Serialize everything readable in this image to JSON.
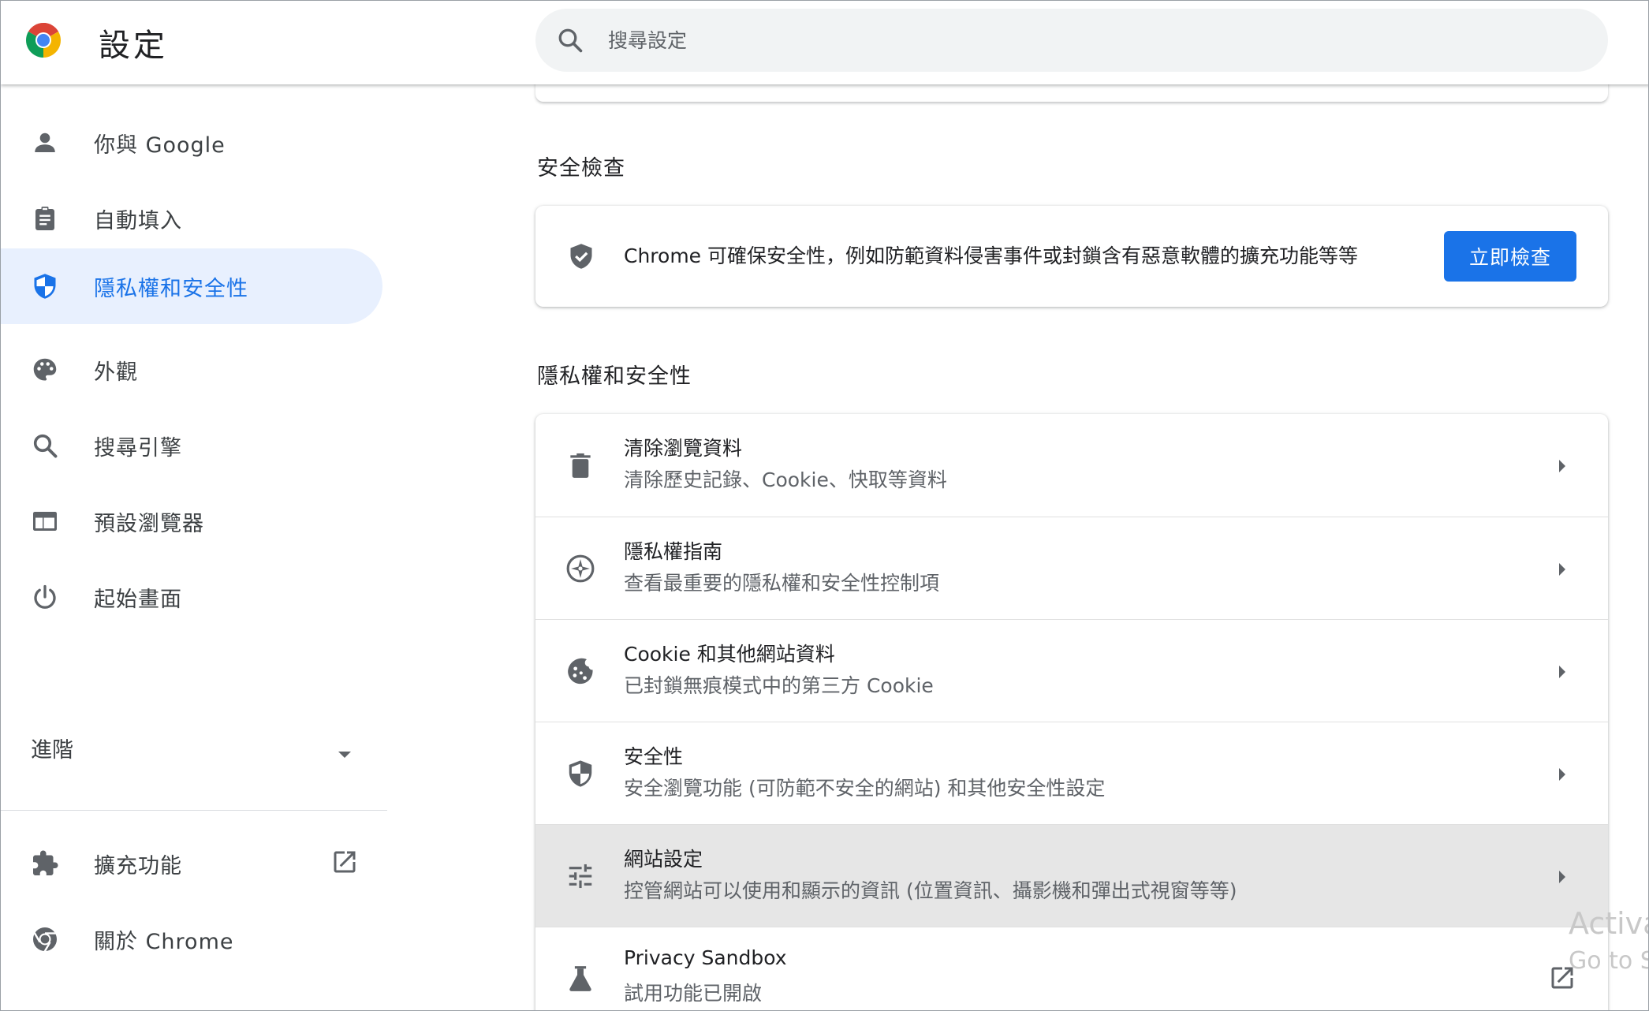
{
  "header": {
    "title": "設定",
    "search_placeholder": "搜尋設定",
    "brand_colors": [
      "#db4437",
      "#0f9d58",
      "#f4b400",
      "#4285f4"
    ]
  },
  "sidebar": {
    "items": [
      {
        "label": "你與 Google",
        "icon": "person-icon"
      },
      {
        "label": "自動填入",
        "icon": "clipboard-icon"
      },
      {
        "label": "隱私權和安全性",
        "icon": "shield-icon",
        "active": true
      },
      {
        "label": "外觀",
        "icon": "palette-icon"
      },
      {
        "label": "搜尋引擎",
        "icon": "search-icon"
      },
      {
        "label": "預設瀏覽器",
        "icon": "browser-window-icon"
      },
      {
        "label": "起始畫面",
        "icon": "power-icon"
      }
    ],
    "advanced_label": "進階",
    "extensions_label": "擴充功能",
    "about_label": "關於 Chrome"
  },
  "main": {
    "safety_check": {
      "title": "安全檢查",
      "description": "Chrome 可確保安全性，例如防範資料侵害事件或封鎖含有惡意軟體的擴充功能等等",
      "button_label": "立即檢查"
    },
    "privacy": {
      "title": "隱私權和安全性",
      "rows": [
        {
          "title": "清除瀏覽資料",
          "subtitle": "清除歷史記錄、Cookie、快取等資料",
          "icon": "trash-icon"
        },
        {
          "title": "隱私權指南",
          "subtitle": "查看最重要的隱私權和安全性控制項",
          "icon": "compass-icon"
        },
        {
          "title": "Cookie 和其他網站資料",
          "subtitle": "已封鎖無痕模式中的第三方 Cookie",
          "icon": "cookie-icon"
        },
        {
          "title": "安全性",
          "subtitle": "安全瀏覽功能 (可防範不安全的網站) 和其他安全性設定",
          "icon": "security-shield-icon"
        },
        {
          "title": "網站設定",
          "subtitle": "控管網站可以使用和顯示的資訊 (位置資訊、攝影機和彈出式視窗等等)",
          "icon": "tune-icon"
        },
        {
          "title": "Privacy Sandbox",
          "subtitle": "試用功能已開啟",
          "icon": "flask-icon"
        }
      ]
    }
  },
  "watermark": {
    "line1": "Activa",
    "line2": "Go to Se"
  },
  "colors": {
    "accent": "#1a73e8",
    "active_bg": "#e8f0fe",
    "hover_row_bg": "#e6e6e6",
    "icon_gray": "#5f6368"
  }
}
